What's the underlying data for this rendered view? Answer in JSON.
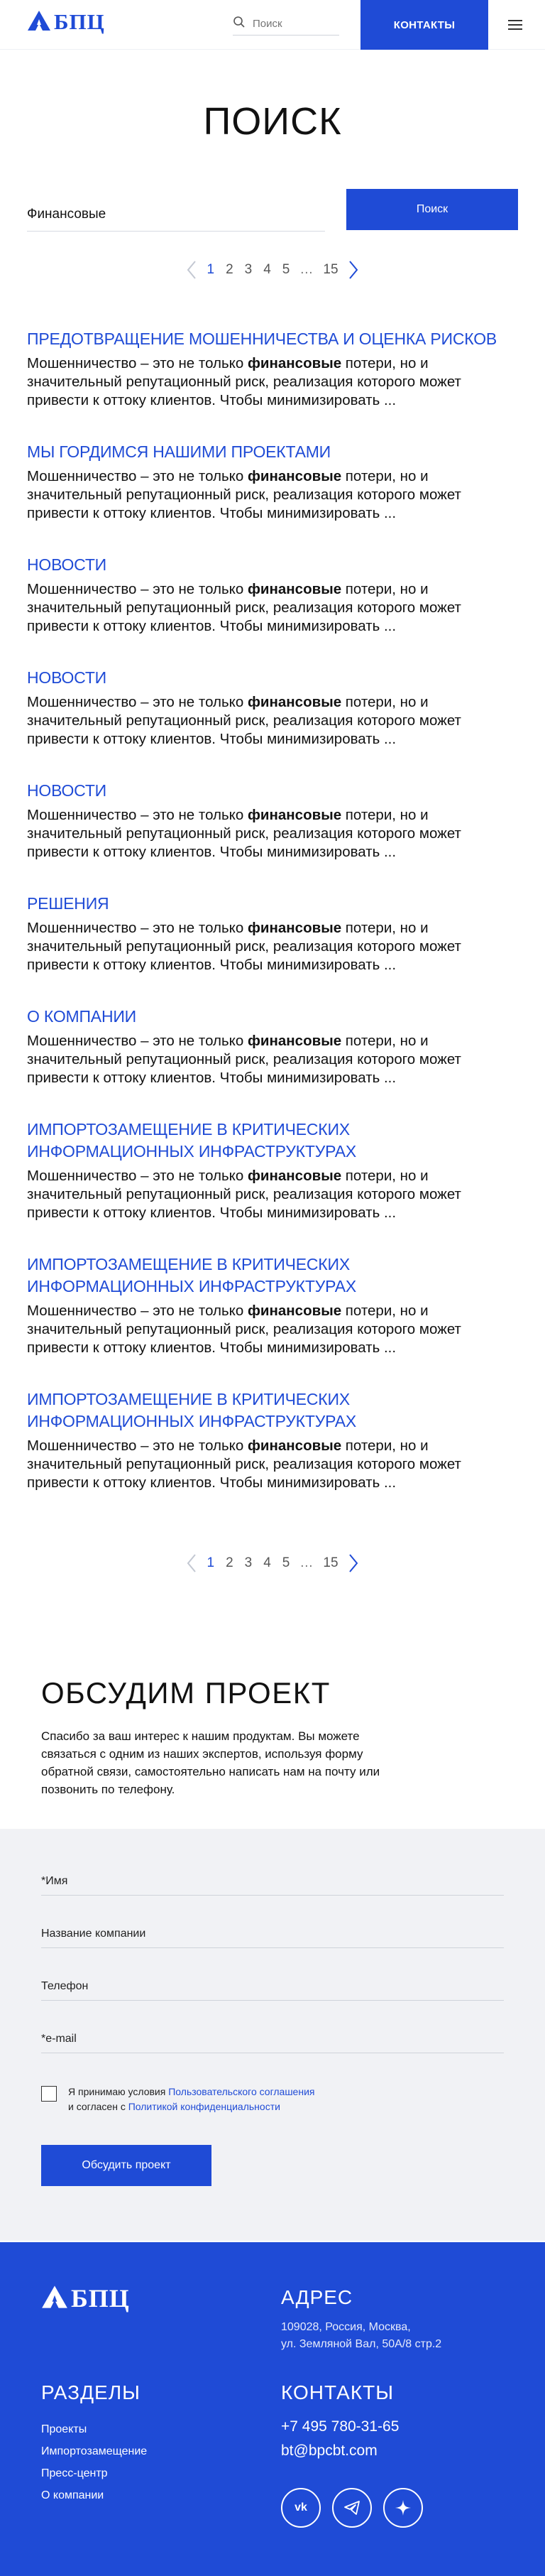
{
  "header": {
    "logo_text": "БПЦ",
    "search_placeholder": "Поиск",
    "contacts_label": "КОНТАКТЫ"
  },
  "page_title": "ПОИСК",
  "search_form": {
    "query_value": "Финансовые",
    "button_label": "Поиск"
  },
  "pagination": {
    "pages": [
      "1",
      "2",
      "3",
      "4",
      "5"
    ],
    "active_page": "1",
    "ellipsis": "…",
    "last_page": "15"
  },
  "results": [
    {
      "title": "Предотвращение мошенничества и оценка рисков",
      "before": "Мошенничество – это не только ",
      "highlight": "финансовые",
      "after": " потери, но и значительный репутационный риск, реализация которого может привести к оттоку клиентов. Чтобы минимизировать ..."
    },
    {
      "title": "Мы гордимся нашими проектами",
      "before": "Мошенничество – это не только ",
      "highlight": "финансовые",
      "after": " потери, но и значительный репутационный риск, реализация которого может привести к оттоку клиентов. Чтобы минимизировать ..."
    },
    {
      "title": "Новости",
      "before": "Мошенничество – это не только ",
      "highlight": "финансовые",
      "after": " потери, но и значительный репутационный риск, реализация которого может привести к оттоку клиентов. Чтобы минимизировать ..."
    },
    {
      "title": "Новости",
      "before": "Мошенничество – это не только ",
      "highlight": "финансовые",
      "after": " потери, но и значительный репутационный риск, реализация которого может привести к оттоку клиентов. Чтобы минимизировать ..."
    },
    {
      "title": "Новости",
      "before": "Мошенничество – это не только ",
      "highlight": "финансовые",
      "after": " потери, но и значительный репутационный риск, реализация которого может привести к оттоку клиентов. Чтобы минимизировать ..."
    },
    {
      "title": "Решения",
      "before": "Мошенничество – это не только ",
      "highlight": "финансовые",
      "after": " потери, но и значительный репутационный риск, реализация которого может привести к оттоку клиентов. Чтобы минимизировать ..."
    },
    {
      "title": "О компании",
      "before": "Мошенничество – это не только ",
      "highlight": "финансовые",
      "after": " потери, но и значительный репутационный риск, реализация которого может привести к оттоку клиентов. Чтобы минимизировать ..."
    },
    {
      "title": "Импортозамещение в критических информационных инфраструктурах",
      "before": "Мошенничество – это не только ",
      "highlight": "финансовые",
      "after": " потери, но и значительный репутационный риск, реализация которого может привести к оттоку клиентов. Чтобы минимизировать ..."
    },
    {
      "title": "Импортозамещение в критических информационных инфраструктурах",
      "before": "Мошенничество – это не только ",
      "highlight": "финансовые",
      "after": " потери, но и значительный репутационный риск, реализация которого может привести к оттоку клиентов. Чтобы минимизировать ..."
    },
    {
      "title": "Импортозамещение в критических информационных инфраструктурах",
      "before": "Мошенничество – это не только ",
      "highlight": "финансовые",
      "after": " потери, но и значительный репутационный риск, реализация которого может привести к оттоку клиентов. Чтобы минимизировать ..."
    }
  ],
  "discuss": {
    "title": "ОБСУДИМ ПРОЕКТ",
    "text": "Спасибо за ваш интерес к нашим продуктам. Вы можете связаться с одним из наших экспертов, используя форму обратной связи, самостоятельно написать нам на почту или позвонить по телефону."
  },
  "form": {
    "name_placeholder": "*Имя",
    "company_placeholder": "Название компании",
    "phone_placeholder": "Телефон",
    "email_placeholder": "*e-mail",
    "consent_prefix": "Я принимаю условия ",
    "consent_link1": "Пользовательского соглашения",
    "consent_middle": "и согласен с ",
    "consent_link2": "Политикой конфиденциальности",
    "submit_label": "Обсудить проект"
  },
  "footer": {
    "logo_text": "БПЦ",
    "address_heading": "АДРЕС",
    "address_line1": "109028, Россия, Москва,",
    "address_line2": "ул. Земляной Вал, 50А/8 стр.2",
    "sections_heading": "РАЗДЕЛЫ",
    "links": [
      "Проекты",
      "Импортозамещение",
      "Пресс-центр",
      "О компании"
    ],
    "contacts_heading": "КОНТАКТЫ",
    "phone": "+7 495 780-31-65",
    "email": "bt@bpcbt.com",
    "social_vk": "vk"
  },
  "colors": {
    "accent": "#1f4bd6",
    "form_bg": "#f1f2f5"
  }
}
